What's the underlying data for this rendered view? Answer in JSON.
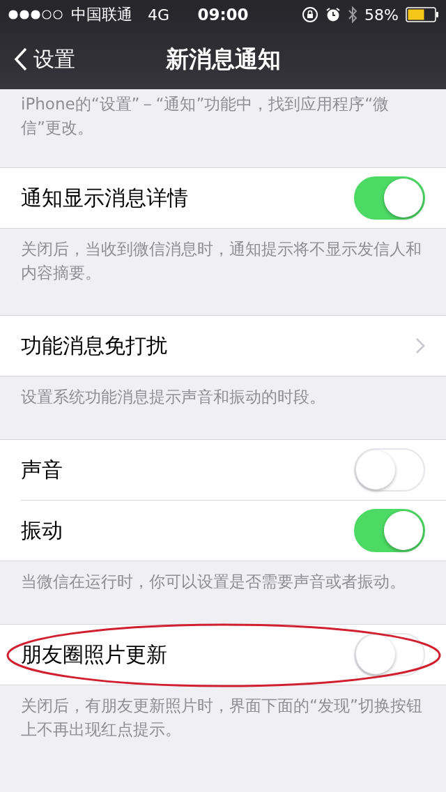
{
  "status_bar": {
    "carrier": "中国联通",
    "network": "4G",
    "time": "09:00",
    "battery": "58%"
  },
  "nav": {
    "back": "设置",
    "title": "新消息通知"
  },
  "top_note": "iPhone的“设置”－“通知”功能中，找到应用程序“微信”更改。",
  "groups": [
    {
      "rows": [
        {
          "kind": "toggle",
          "label": "通知显示消息详情",
          "on": true,
          "highlighted": false
        }
      ],
      "footer": "关闭后，当收到微信消息时，通知提示将不显示发信人和内容摘要。"
    },
    {
      "rows": [
        {
          "kind": "link",
          "label": "功能消息免打扰",
          "highlighted": false
        }
      ],
      "footer": "设置系统功能消息提示声音和振动的时段。"
    },
    {
      "rows": [
        {
          "kind": "toggle",
          "label": "声音",
          "on": false,
          "highlighted": false
        },
        {
          "kind": "toggle",
          "label": "振动",
          "on": true,
          "highlighted": false
        }
      ],
      "footer": "当微信在运行时，你可以设置是否需要声音或者振动。"
    },
    {
      "rows": [
        {
          "kind": "toggle",
          "label": "朋友圈照片更新",
          "on": false,
          "highlighted": true
        }
      ],
      "footer": "关闭后，有朋友更新照片时，界面下面的“发现”切换按钮上不再出现红点提示。"
    }
  ]
}
